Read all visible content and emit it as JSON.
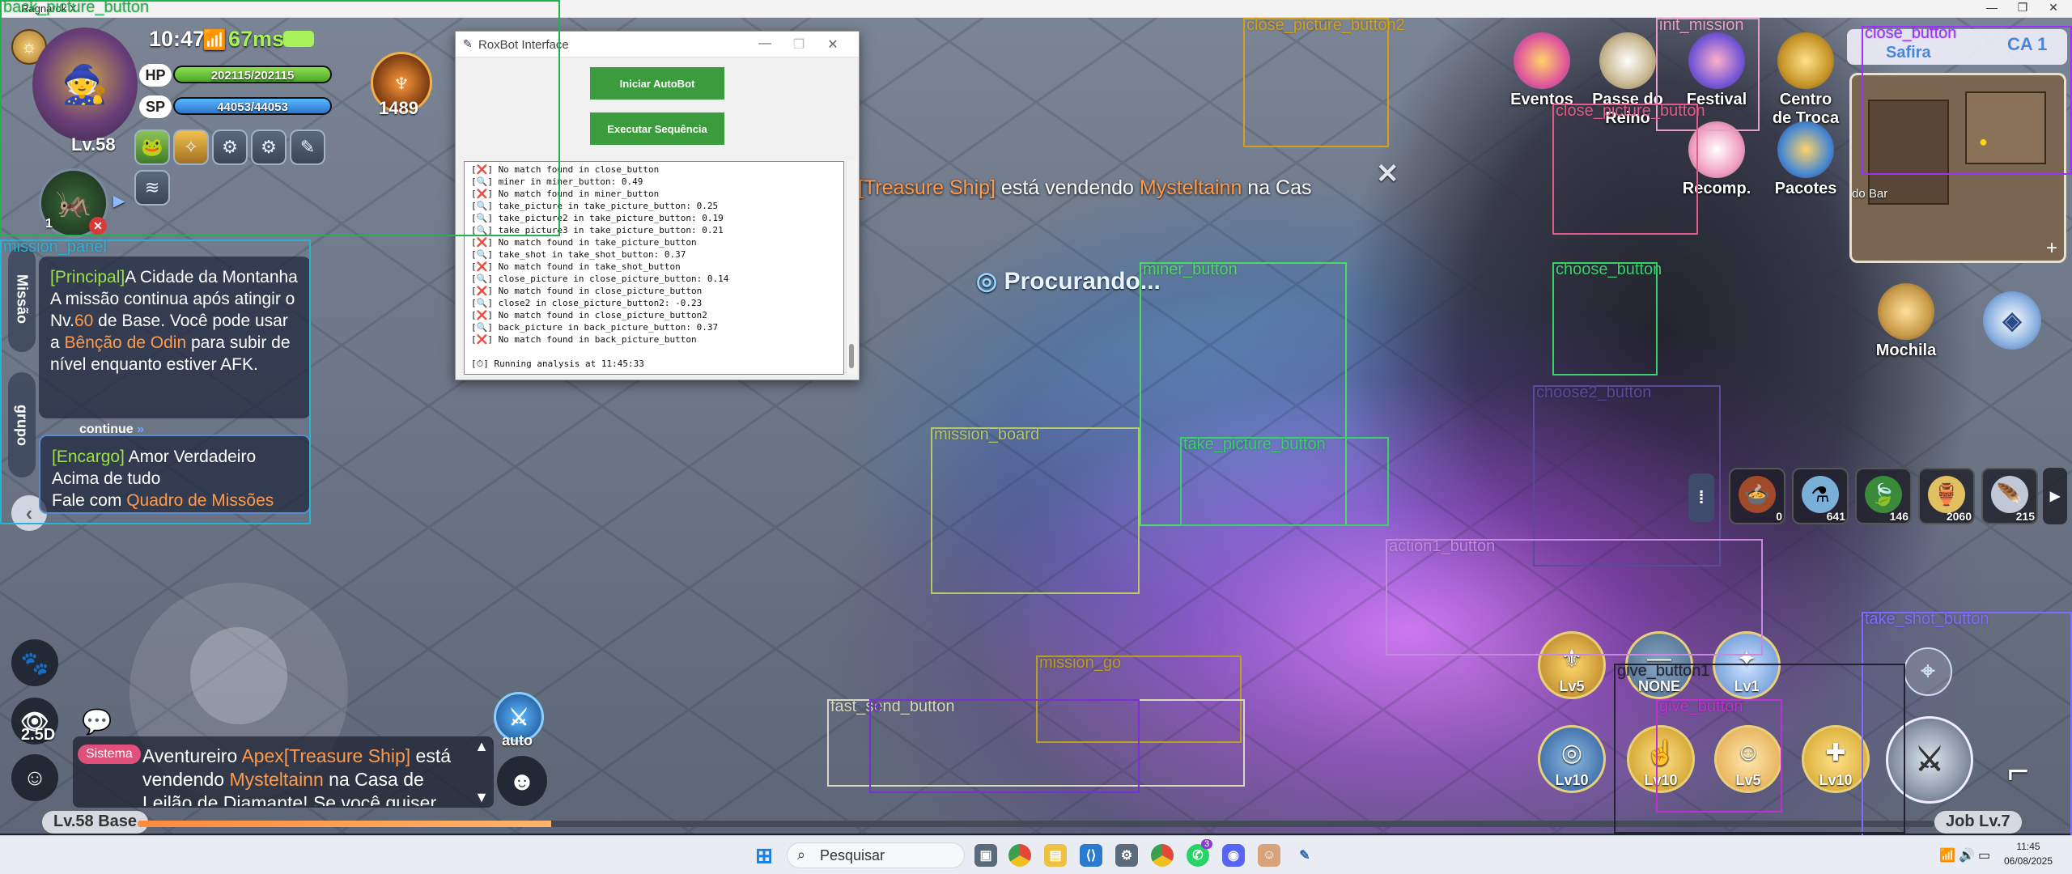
{
  "window": {
    "title": "Ragnarok X",
    "minimize": "—",
    "maximize": "❐",
    "close": "✕"
  },
  "hud": {
    "time": "10:47",
    "ping": "67ms",
    "level": "Lv.58",
    "hp_label": "HP",
    "hp_value": "202115/202115",
    "hp_fraction": 1.0,
    "sp_label": "SP",
    "sp_value": "44053/44053",
    "sp_fraction": 1.0,
    "power": "1489",
    "pet_count": "1"
  },
  "mission": {
    "side_tab_mission": "Missão",
    "side_tab_group": "grupo",
    "main_tag": "[Principal]",
    "main_title": "A Cidade da Montanha",
    "main_line1": "A missão continua após atingir o Nv.",
    "main_level": "60",
    "main_line2": " de Base. Você pode usar a ",
    "main_highlight": "Bênção de Odin",
    "main_line3": " para subir de nível enquanto estiver AFK.",
    "continue_label": "continue",
    "task_tag": "[Encargo]",
    "task_title": " Amor Verdadeiro Acima de tudo",
    "task_line": "Fale com ",
    "task_highlight": "Quadro de Missões"
  },
  "notice": {
    "tag": "[Treasure Ship]",
    "text_a": " está vendendo ",
    "item": "Mysteltainn",
    "text_b": " na Cas"
  },
  "searching": "Procurando...",
  "roxbot": {
    "title": "RoxBot Interface",
    "btn_start": "Iniciar AutoBot",
    "btn_sequence": "Executar Sequência",
    "log": [
      "[❌] No match found in close_button",
      "[🔍] miner in miner_button: 0.49",
      "[❌] No match found in miner_button",
      "[🔍] take_picture in take_picture_button: 0.25",
      "[🔍] take_picture2 in take_picture_button: 0.19",
      "[🔍] take_picture3 in take_picture_button: 0.21",
      "[❌] No match found in take_picture_button",
      "[🔍] take_shot in take_shot_button: 0.37",
      "[❌] No match found in take_shot_button",
      "[🔍] close_picture in close_picture_button: 0.14",
      "[❌] No match found in close_picture_button",
      "[🔍] close2 in close_picture_button2: -0.23",
      "[❌] No match found in close_picture_button2",
      "[🔍] back_picture in back_picture_button: 0.37",
      "[❌] No match found in back_picture_button",
      "",
      "[⏱] Running analysis at 11:45:33"
    ]
  },
  "detections": [
    {
      "id": "back_picture_button",
      "label": "back_picture_button",
      "color": "#22b14c"
    },
    {
      "id": "close_picture_button2",
      "label": "close_picture_button2",
      "color": "#d4a017"
    },
    {
      "id": "init_mission",
      "label": "init_mission",
      "color": "#e6a0c8"
    },
    {
      "id": "close_button",
      "label": "close_button",
      "color": "#9b30ff"
    },
    {
      "id": "close_picture_button",
      "label": "close_picture_button",
      "color": "#e05c8a"
    },
    {
      "id": "mission_panel",
      "label": "mission_panel",
      "color": "#28b4d8"
    },
    {
      "id": "miner_button",
      "label": "miner_button",
      "color": "#4cd964"
    },
    {
      "id": "choose_button",
      "label": "choose_button",
      "color": "#3ad16a"
    },
    {
      "id": "choose2_button",
      "label": "choose2_button",
      "color": "#5a4a9a"
    },
    {
      "id": "mission_board",
      "label": "mission_board",
      "color": "#b5c76a"
    },
    {
      "id": "take_picture_button",
      "label": "take_picture_button",
      "color": "#3ad16a"
    },
    {
      "id": "action1_button",
      "label": "action1_button",
      "color": "#c58adf"
    },
    {
      "id": "take_shot_button",
      "label": "take_shot_button",
      "color": "#7d6cff"
    },
    {
      "id": "mission_go",
      "label": "mission_go",
      "color": "#b8a020"
    },
    {
      "id": "fast_send_button",
      "label": "fast_send_button",
      "color": "#d8d8c0"
    },
    {
      "id": "fast_send_hidden",
      "label": "e",
      "color": "#7a2fd0"
    },
    {
      "id": "give_button1",
      "label": "give_button1",
      "color": "#222233"
    },
    {
      "id": "give_button",
      "label": "give_button",
      "color": "#c02fd0"
    }
  ],
  "right_icons": {
    "eventos": "Eventos",
    "passe": "Passe do Reino",
    "festival": "Festival",
    "centro": "Centro de Troca",
    "recomp": "Recomp.",
    "pacotes": "Pacotes",
    "mochila": "Mochila"
  },
  "minimap": {
    "zone": "Safira",
    "channel": "CA 1",
    "place": "do Bar"
  },
  "items": [
    {
      "name": "potion-bowl",
      "count": "0"
    },
    {
      "name": "flask",
      "count": "641"
    },
    {
      "name": "leaf",
      "count": "146"
    },
    {
      "name": "oil-jar",
      "count": "2060"
    },
    {
      "name": "wing",
      "count": "215"
    }
  ],
  "skills": [
    {
      "lv": "Lv5"
    },
    {
      "lv": "NONE"
    },
    {
      "lv": "Lv1"
    },
    {
      "lv": "Lv10"
    },
    {
      "lv": "Lv10"
    },
    {
      "lv": "Lv5"
    },
    {
      "lv": "Lv10"
    }
  ],
  "controls": {
    "auto_label": "auto",
    "view_label": "2.5D"
  },
  "chat": {
    "channel": "Sistema",
    "sender": "Aventureiro ",
    "sender_hl": "Apex[Treasure Ship]",
    "text_a": " está vendendo ",
    "item": "Mysteltainn",
    "text_b": " na Casa de Leilão de Diamante! Se você quiser"
  },
  "exp": {
    "base_label": "Lv.58 Base",
    "job_label": "Job Lv.7",
    "base_fraction": 0.23
  },
  "taskbar": {
    "search": "Pesquisar",
    "clock_time": "11:45",
    "clock_date": "06/08/2025",
    "badge_whatsapp": "3"
  },
  "colors": {
    "accent_green": "#3a9c3c",
    "hp_green": "#6fd13c",
    "sp_blue": "#3aa0ff",
    "exp_orange": "#ff8a3a"
  }
}
